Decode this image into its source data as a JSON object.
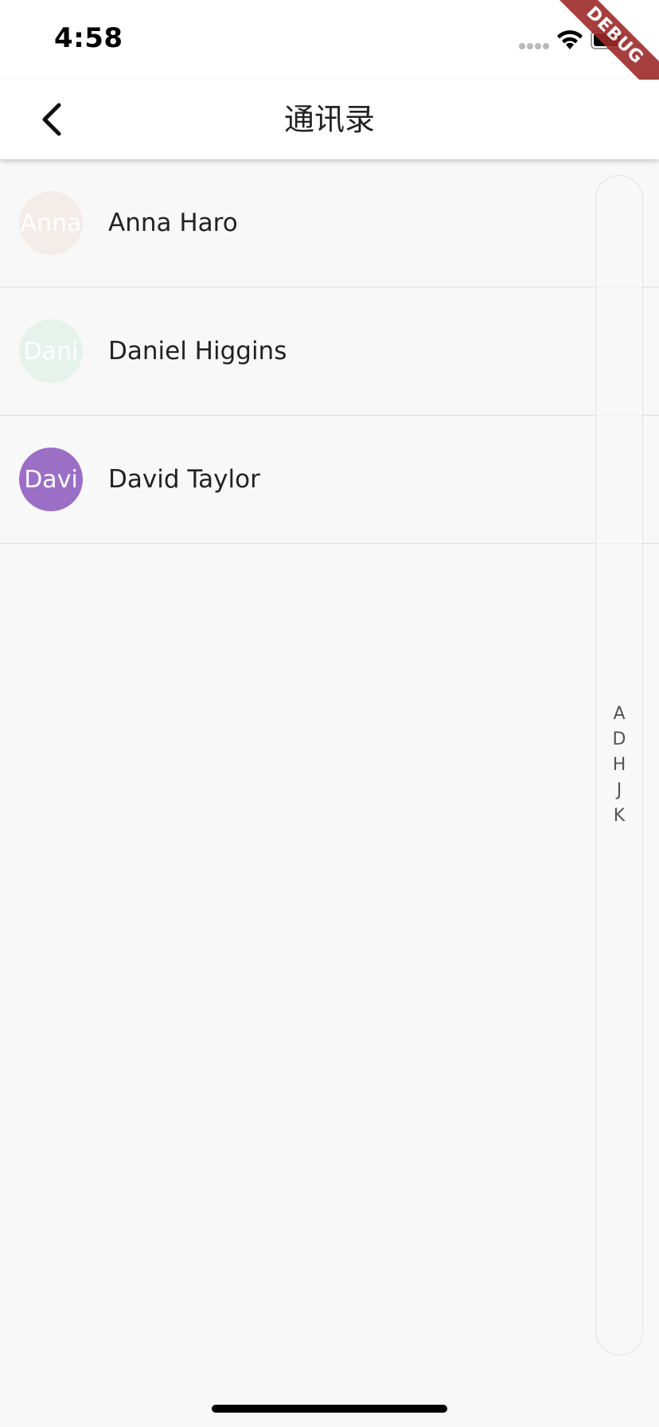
{
  "status_bar": {
    "time": "4:58",
    "debug_label": "DEBUG"
  },
  "app_bar": {
    "title": "通讯录",
    "back_icon": "chevron-left-icon"
  },
  "contacts": [
    {
      "initials": "Anna",
      "name": "Anna Haro",
      "avatar_color": "#f3ece8"
    },
    {
      "initials": "Dani",
      "name": "Daniel Higgins",
      "avatar_color": "#e6f2ec"
    },
    {
      "initials": "Davi",
      "name": "David Taylor",
      "avatar_color": "#9b6fc6"
    }
  ],
  "index_bar": {
    "letters": [
      "A",
      "D",
      "H",
      "J",
      "K"
    ]
  }
}
